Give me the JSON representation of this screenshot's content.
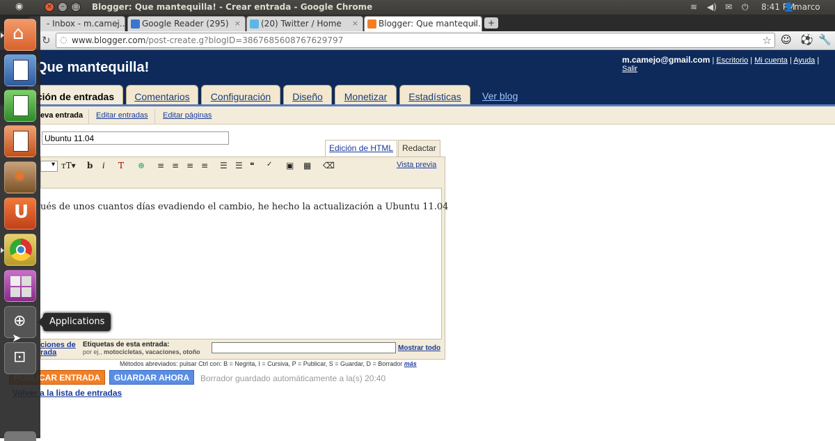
{
  "top_panel": {
    "window_title": "Blogger: Que mantequilla! - Crear entrada - Google Chrome",
    "clock": "8:41 PM",
    "user": "marco"
  },
  "tabs": [
    {
      "label": "- Inbox - m.camej…"
    },
    {
      "label": "Google Reader (295)"
    },
    {
      "label": "(20) Twitter / Home"
    },
    {
      "label": "Blogger: Que mantequil…"
    }
  ],
  "address": {
    "host": "www.blogger.com",
    "path": "/post-create.g?blogID=3867685608767629797"
  },
  "blog": {
    "title": "Que mantequilla!",
    "email": "m.camejo@gmail.com",
    "links": [
      "Escritorio",
      "Mi cuenta",
      "Ayuda",
      "Salir"
    ]
  },
  "main_tabs": [
    "ción de entradas",
    "Comentarios",
    "Configuración",
    "Diseño",
    "Monetizar",
    "Estadísticas"
  ],
  "view_blog": "Ver blog",
  "sub_tabs": [
    "eva entrada",
    "Editar entradas",
    "Editar páginas"
  ],
  "post": {
    "title": "Ubuntu 11.04",
    "body": "ués de unos cuantos días evadiendo el cambio, he hecho la actualización a Ubuntu 11.04"
  },
  "editor_modes": {
    "html": "Edición de HTML",
    "compose": "Redactar"
  },
  "preview": "Vista previa",
  "labels": {
    "options_link_1": "ciones de",
    "options_link_2": "rada",
    "title": "Etiquetas de esta entrada:",
    "hint_prefix": "por ej., ",
    "hint_examples": "motocicletas, vacaciones, otoño",
    "show_all": "Mostrar todo"
  },
  "shortcuts": {
    "text": "Métodos abreviados: pulsar Ctrl con: B = Negrita, I = Cursiva, P = Publicar, S = Guardar, D = Borrador",
    "more": "más"
  },
  "buttons": {
    "publish": "PUBLICAR ENTRADA",
    "save": "GUARDAR AHORA"
  },
  "autosave": "Borrador guardado automáticamente a la(s) 20:40",
  "back_link": "Volver a la lista de entradas",
  "launcher_tooltip": "Applications",
  "colors": {
    "header": "#0d2a5a",
    "tab_bg": "#f3ecda",
    "publish": "#f37f24",
    "save": "#5a8de3"
  }
}
